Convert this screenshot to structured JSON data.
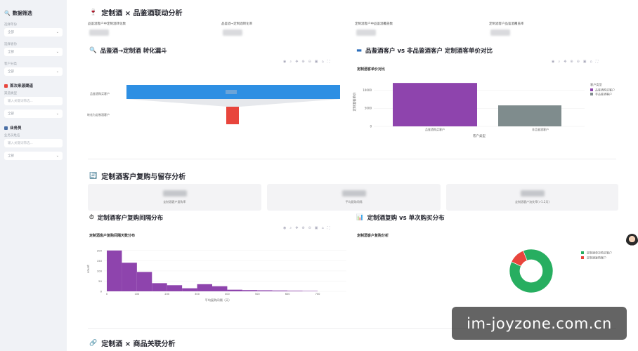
{
  "sidebar": {
    "title": "数据筛选",
    "filters": [
      {
        "label": "选择年份",
        "value": "全部"
      },
      {
        "label": "选择省份",
        "value": "全部"
      },
      {
        "label": "客户分类",
        "value": "全部"
      }
    ],
    "source_section": "首次来源渠道",
    "source_label": "渠道类型",
    "source_placeholder": "输入关键词筛选...",
    "source_select": "全部",
    "sales_section": "业务员",
    "sales_label": "业务员姓名",
    "sales_placeholder": "输入关键词筛选...",
    "sales_select": "全部"
  },
  "section1": {
    "title": "定制酒 × 品鉴酒联动分析",
    "metrics": [
      "品鉴酒客户中定制酒转化数",
      "品鉴酒→定制酒转化率",
      "定制酒客户中品鉴酒覆盖数",
      "定制酒客户品鉴酒覆盖率"
    ]
  },
  "funnel": {
    "title": "品鉴酒→定制酒 转化漏斗",
    "labels": [
      "品鉴酒购买客户",
      "转化为定制酒客户"
    ]
  },
  "compare": {
    "title": "品鉴酒客户 vs 非品鉴酒客户 定制酒客单价对比",
    "chart_title": "定制酒客单价对比",
    "ylabel": "定制酒客单价",
    "xlabel": "客户类型",
    "categories": [
      "品鉴酒购买客户",
      "非品鉴酒客户"
    ],
    "yticks": [
      "0",
      "5000",
      "10000"
    ],
    "legend_title": "客户类型",
    "legend": [
      "品鉴酒购买客户",
      "非品鉴酒客户"
    ]
  },
  "section2": {
    "title": "定制酒客户复购与留存分析",
    "cards": [
      "定制酒客户复购率",
      "平均复购间隔",
      "定制酒客户流失率(>1.2月)"
    ]
  },
  "interval": {
    "title": "定制酒客户复购间隔分布",
    "chart_title": "定制酒客户复购间隔天数分布",
    "xlabel": "平均复购间隔（天）",
    "ylabel": "count",
    "yticks": [
      "0",
      "50",
      "100",
      "150",
      "200"
    ],
    "xticks": [
      "0",
      "100",
      "200",
      "300",
      "400",
      "500",
      "600",
      "700"
    ]
  },
  "repeat_vs_single": {
    "title": "定制酒复购 vs 单次购买分布",
    "chart_title": "定制酒客户复购分析",
    "legend": [
      "定制酒单次购买客户",
      "定制酒复购客户"
    ]
  },
  "section3": {
    "title": "定制酒 × 商品关联分析"
  },
  "toolbar_icons": [
    "camera-icon",
    "zoom-icon",
    "pan-icon",
    "zoom-in-icon",
    "zoom-out-icon",
    "autoscale-icon",
    "reset-icon",
    "fullscreen-icon"
  ],
  "watermark": "im-joyzone.com.cn",
  "colors": {
    "accent_blue": "#2e8fe3",
    "red": "#e8453c",
    "purple": "#8e44ad",
    "gray": "#7f8c8d",
    "green": "#27ae60",
    "sidebar_bg": "#f0f2f6"
  },
  "chart_data": [
    {
      "type": "bar",
      "title": "定制酒客单价对比",
      "categories": [
        "品鉴酒购买客户",
        "非品鉴酒客户"
      ],
      "values": [
        12000,
        5800
      ],
      "xlabel": "客户类型",
      "ylabel": "定制酒客单价",
      "ylim": [
        0,
        13000
      ]
    },
    {
      "type": "bar",
      "title": "定制酒客户复购间隔天数分布",
      "categories": [
        "0-50",
        "50-100",
        "100-150",
        "150-200",
        "200-250",
        "250-300",
        "300-350",
        "350-400",
        "400-450",
        "450-500",
        "500-550",
        "550-600",
        "600-650",
        "650-700"
      ],
      "values": [
        200,
        140,
        95,
        40,
        30,
        15,
        35,
        25,
        8,
        6,
        5,
        4,
        3,
        2
      ],
      "xlabel": "平均复购间隔（天）",
      "ylabel": "count",
      "ylim": [
        0,
        220
      ]
    },
    {
      "type": "pie",
      "title": "定制酒客户复购分析",
      "categories": [
        "定制酒单次购买客户",
        "定制酒复购客户"
      ],
      "values": [
        88,
        12
      ]
    }
  ]
}
